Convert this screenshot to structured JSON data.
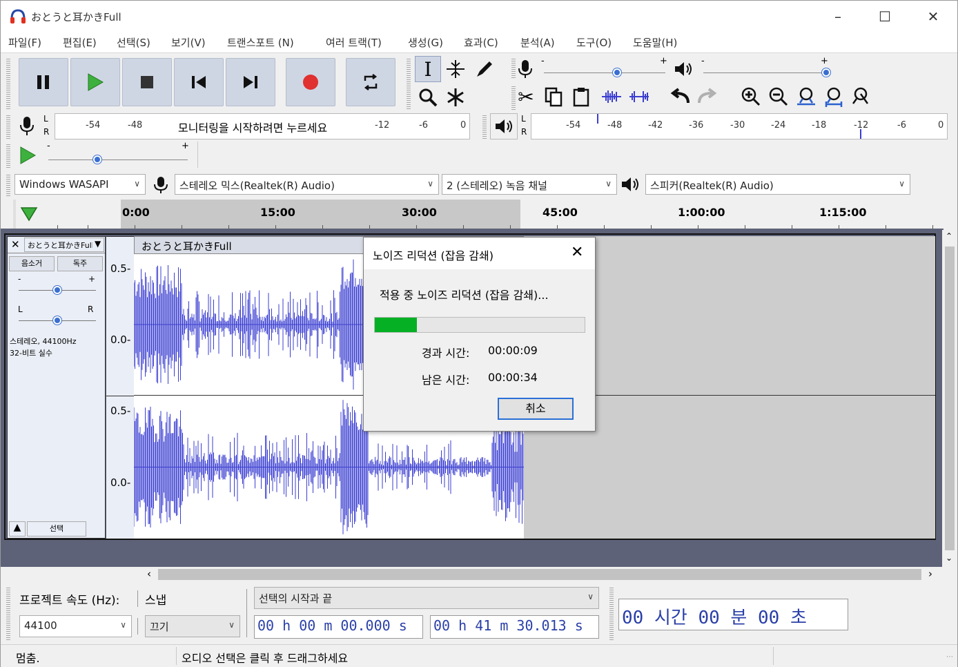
{
  "window": {
    "title": "おとうと耳かきFull"
  },
  "menu": [
    "파일(F)",
    "편집(E)",
    "선택(S)",
    "보기(V)",
    "트랜스포트 (N)",
    "여러 트랙(T)",
    "생성(G)",
    "효과(C)",
    "분석(A)",
    "도구(O)",
    "도움말(H)"
  ],
  "meters": {
    "record_ticks": [
      "-54",
      "-48",
      "-12",
      "-6",
      "0"
    ],
    "record_prompt": "모니터링을 시작하려면 누르세요",
    "play_ticks": [
      "-54",
      "-48",
      "-42",
      "-36",
      "-30",
      "-24",
      "-18",
      "-12",
      "-6",
      "0"
    ],
    "lr_L": "L",
    "lr_R": "R",
    "minus": "-",
    "plus": "+",
    "record_gain_level": 0.6,
    "playback_volume_level": 1.0,
    "play_speed_level": 0.35
  },
  "device": {
    "host": "Windows WASAPI",
    "input": "스테레오 믹스(Realtek(R) Audio)",
    "channels": "2 (스테레오) 녹음 채널",
    "output": "스피커(Realtek(R) Audio)"
  },
  "timeline": {
    "labels": [
      "0:00",
      "15:00",
      "30:00",
      "45:00",
      "1:00:00",
      "1:15:00"
    ],
    "selection_end_fraction": 0.55
  },
  "track": {
    "name": "おとうと耳かきFull",
    "mute": "음소거",
    "solo": "독주",
    "gain_minus": "-",
    "gain_plus": "+",
    "pan_L": "L",
    "pan_R": "R",
    "info_line1": "스테레오, 44100Hz",
    "info_line2": "32-비트 실수",
    "select": "선택",
    "clip_name": "おとうと耳かきFull",
    "axis": [
      "0.5-",
      "0.0-",
      "0.5-",
      "0.0-"
    ],
    "gain_level": 0.5,
    "pan_level": 0.5
  },
  "dialog": {
    "title": "노이즈 리덕션 (잡음 감쇄)",
    "message": "적용 중 노이즈 리덕션 (잡음 감쇄)...",
    "progress": 0.2,
    "elapsed_label": "경과 시간:",
    "elapsed": "00:00:09",
    "remaining_label": "남은 시간:",
    "remaining": "00:00:34",
    "cancel": "취소"
  },
  "bottom": {
    "rate_label": "프로젝트 속도 (Hz):",
    "rate": "44100",
    "snap_label": "스냅",
    "snap_value": "끄기",
    "sel_mode": "선택의 시작과 끝",
    "start_time": "00 h 00 m 00.000 s",
    "end_time": "00 h 41 m 30.013 s",
    "big_time": "00 시간 00 분 00 초"
  },
  "status": {
    "left": "멈춤.",
    "right": "오디오 선택은 클릭 후 드래그하세요"
  },
  "colors": {
    "accent": "#3a3dd0",
    "progress": "#06b025",
    "toolbar_button": "#cfd6e3",
    "track_bg": "#5e6278"
  }
}
